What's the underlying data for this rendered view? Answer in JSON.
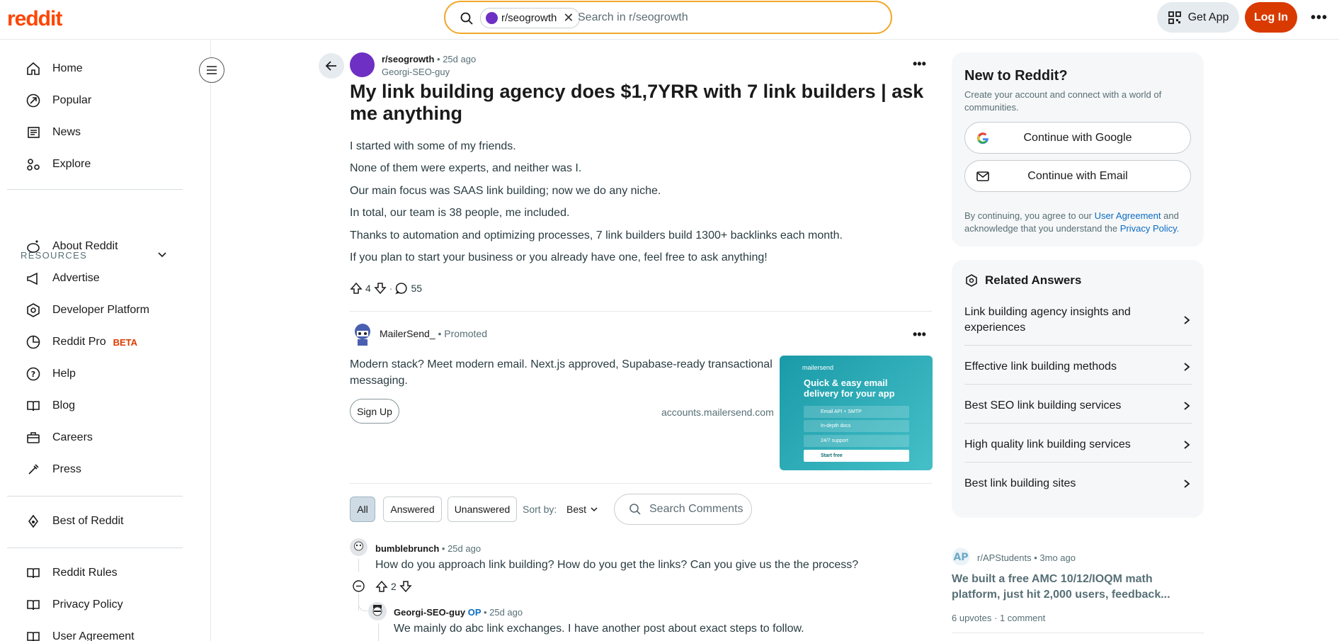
{
  "header": {
    "logo": "reddit",
    "search_chip": "r/seogrowth",
    "search_placeholder": "Search in r/seogrowth",
    "get_app": "Get App",
    "login": "Log In"
  },
  "leftnav": {
    "top": [
      "Home",
      "Popular",
      "News",
      "Explore"
    ],
    "resources_heading": "RESOURCES",
    "resources": [
      "About Reddit",
      "Advertise",
      "Developer Platform",
      "Reddit Pro",
      "Help",
      "Blog",
      "Careers",
      "Press"
    ],
    "beta": "BETA",
    "best_of": "Best of Reddit",
    "bottom": [
      "Reddit Rules",
      "Privacy Policy",
      "User Agreement"
    ]
  },
  "post": {
    "subreddit": "r/seogrowth",
    "time": "25d ago",
    "author": "Georgi-SEO-guy",
    "title": "My link building agency does $1,7YRR with 7 link builders | ask me anything",
    "body": [
      "I started with some of my friends.",
      "None of them were experts, and neither was I.",
      "Our main focus was SAAS link building; now we do any niche.",
      "In total, our team is 38 people, me included.",
      "Thanks to automation and optimizing processes, 7 link builders build 1300+ backlinks each month.",
      "If you plan to start your business or you already have one, feel free to ask anything!"
    ],
    "upvotes": "4",
    "comments": "55"
  },
  "ad": {
    "name": "MailerSend_",
    "promoted": "Promoted",
    "text": "Modern stack? Meet modern email. Next.js approved, Supabase-ready transactional messaging.",
    "cta": "Sign Up",
    "url": "accounts.mailersend.com",
    "image_brand": "mailersend",
    "image_headline": "Quick & easy email delivery for your app",
    "image_rows": [
      "Email API + SMTP",
      "In-depth docs",
      "24/7 support",
      "Start free"
    ]
  },
  "filters": {
    "all": "All",
    "answered": "Answered",
    "unanswered": "Unanswered",
    "sort_label": "Sort by:",
    "sort_value": "Best",
    "search_placeholder": "Search Comments"
  },
  "comments": [
    {
      "user": "bumblebrunch",
      "time": "25d ago",
      "text": "How do you approach link building? How do you get the links? Can you give us the the process?",
      "votes": "2"
    },
    {
      "user": "Georgi-SEO-guy",
      "op": "OP",
      "time": "25d ago",
      "text": "We mainly do abc link exchanges. I have another post about exact steps to follow."
    }
  ],
  "sidebar": {
    "new_title": "New to Reddit?",
    "new_sub": "Create your account and connect with a world of communities.",
    "google": "Continue with Google",
    "email": "Continue with Email",
    "legal_1": "By continuing, you agree to our ",
    "legal_link1": "User Agreement",
    "legal_2": " and acknowledge that you understand the ",
    "legal_link2": "Privacy Policy",
    "legal_3": ".",
    "related_title": "Related Answers",
    "related": [
      "Link building agency insights and experiences",
      "Effective link building methods",
      "Best SEO link building services",
      "High quality link building services",
      "Best link building sites"
    ],
    "recent_sub": "r/APStudents",
    "recent_time": "3mo ago",
    "recent_title": "We built a free AMC 10/12/IOQM math platform, just hit 2,000 users, feedback...",
    "recent_upvotes": "6 upvotes",
    "recent_comments": "1 comment"
  },
  "colors": {
    "brand": "#ff4500",
    "login_bg": "#d93a00",
    "link": "#0a6cc4"
  }
}
